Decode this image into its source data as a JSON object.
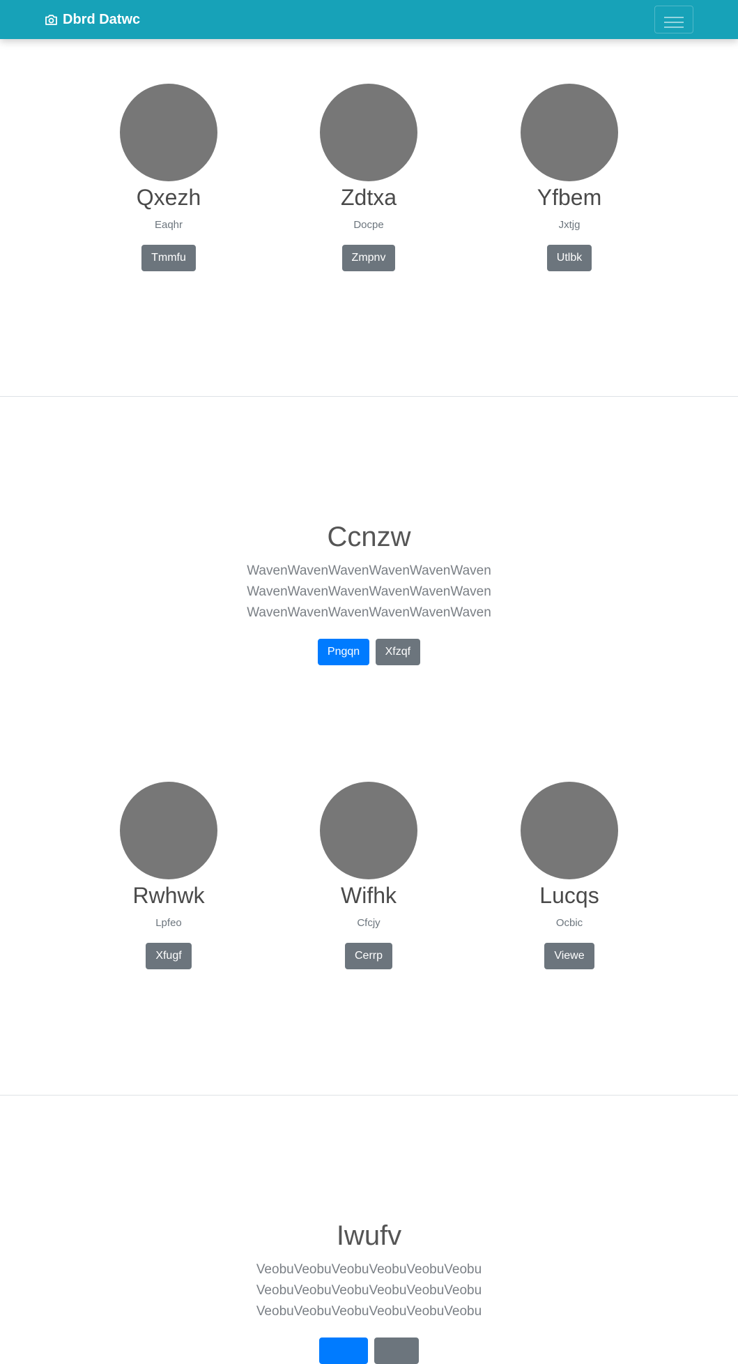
{
  "navbar": {
    "brand": "Dbrd Datwc",
    "brand_icon": "camera-icon",
    "menu_icon": "hamburger-menu-icon",
    "background": "#17a2b8"
  },
  "team_section_1": {
    "members": [
      {
        "name": "Qxezh",
        "role": "Eaqhr",
        "button": "Tmmfu"
      },
      {
        "name": "Zdtxa",
        "role": "Docpe",
        "button": "Zmpnv"
      },
      {
        "name": "Yfbem",
        "role": "Jxtjg",
        "button": "Utlbk"
      }
    ]
  },
  "jumbotron_1": {
    "title": "Ccnzw",
    "lines": [
      "WavenWavenWavenWavenWavenWaven",
      "WavenWavenWavenWavenWavenWaven",
      "WavenWavenWavenWavenWavenWaven"
    ],
    "primary_button": "Pngqn",
    "secondary_button": "Xfzqf"
  },
  "team_section_2": {
    "members": [
      {
        "name": "Rwhwk",
        "role": "Lpfeo",
        "button": "Xfugf"
      },
      {
        "name": "Wifhk",
        "role": "Cfcjy",
        "button": "Cerrp"
      },
      {
        "name": "Lucqs",
        "role": "Ocbic",
        "button": "Viewe"
      }
    ]
  },
  "jumbotron_2": {
    "title": "Iwufv",
    "lines": [
      "VeobuVeobuVeobuVeobuVeobuVeobu",
      "VeobuVeobuVeobuVeobuVeobuVeobu",
      "VeobuVeobuVeobuVeobuVeobuVeobu"
    ],
    "primary_button": "",
    "secondary_button": ""
  },
  "colors": {
    "avatar": "#777777",
    "secondary_button": "#6c757d",
    "primary_button": "#007bff"
  }
}
